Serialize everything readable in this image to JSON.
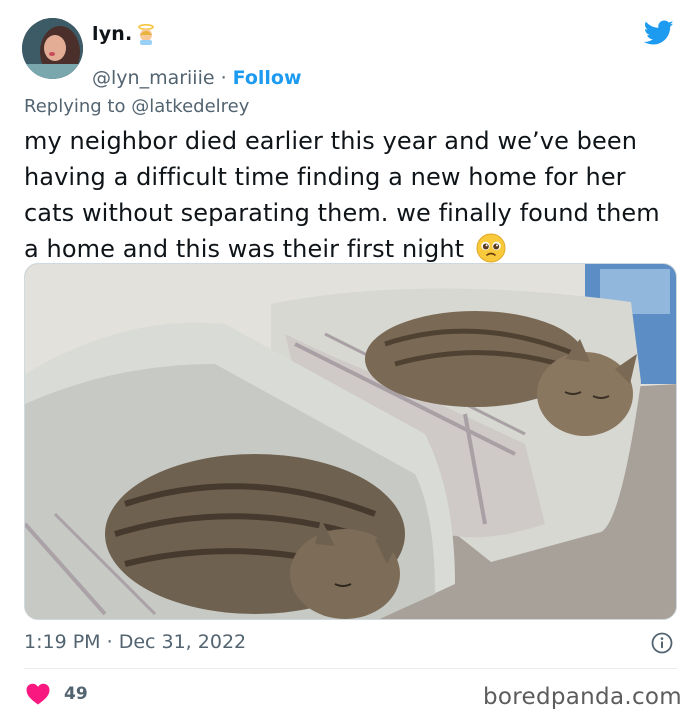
{
  "author": {
    "display_name": "lyn.",
    "handle": "@lyn_mariiie",
    "separator": "·",
    "follow_label": "Follow",
    "name_emoji": "angel-emoji"
  },
  "tweet": {
    "replying_prefix": "Replying to",
    "replying_to": "@latkedelrey",
    "text": "my neighbor died earlier this year and we’ve been having a difficult time finding a new home for her cats without separating them. we finally found them a home and this was their first night",
    "text_emoji": "pleading-face-emoji",
    "image_alt": "two cats sleeping in two separate pet beds",
    "time": "1:19 PM",
    "date_separator": "·",
    "date": "Dec 31, 2022",
    "likes": "49"
  },
  "icons": {
    "brand": "twitter-bird-icon",
    "info": "info-icon",
    "like": "heart-icon"
  },
  "colors": {
    "accent": "#1d9bf0",
    "heart": "#f91880",
    "muted": "#536471"
  },
  "watermark": "boredpanda.com"
}
